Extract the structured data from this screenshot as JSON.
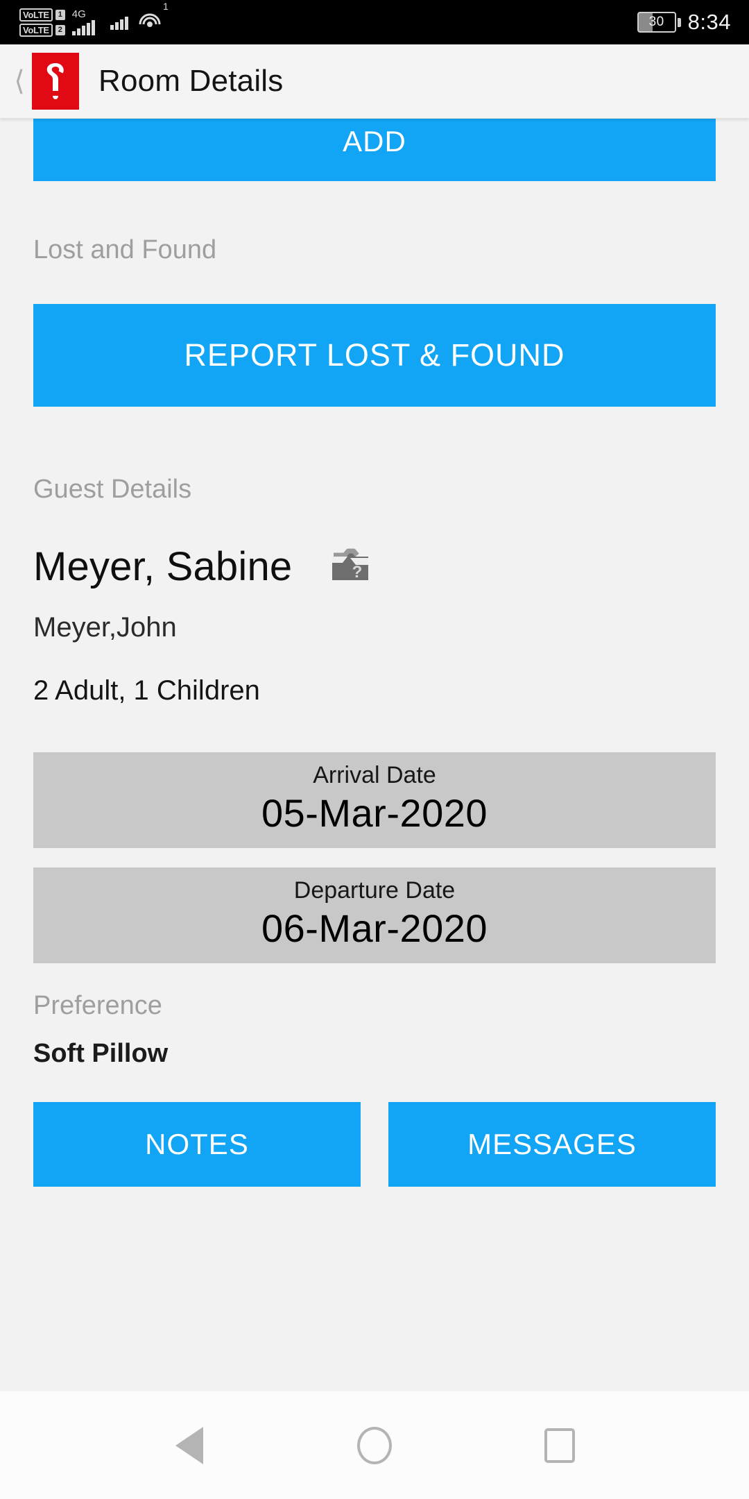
{
  "status_bar": {
    "volte_label": "VoLTE",
    "sim1_number": "1",
    "sim2_number": "2",
    "network_type": "4G",
    "hotspot_superscript": "1",
    "battery_percent": "30",
    "time": "8:34"
  },
  "app_bar": {
    "back_icon": "back-chevron-icon",
    "logo_icon": "door-hanger-logo-icon",
    "title": "Room Details"
  },
  "main": {
    "add_button_label": "ADD",
    "lost_and_found": {
      "section_label": "Lost and Found",
      "report_button_label": "REPORT LOST & FOUND"
    },
    "guest_details": {
      "section_label": "Guest Details",
      "guest_name": "Meyer, Sabine",
      "guest_photo_icon": "broken-image-icon",
      "secondary_guest": "Meyer,John",
      "occupancy": "2 Adult, 1 Children",
      "arrival": {
        "label": "Arrival Date",
        "value": "05-Mar-2020"
      },
      "departure": {
        "label": "Departure Date",
        "value": "06-Mar-2020"
      }
    },
    "preference": {
      "section_label": "Preference",
      "value": "Soft Pillow"
    },
    "actions": {
      "notes_label": "NOTES",
      "messages_label": "MESSAGES"
    }
  },
  "nav_bar": {
    "back": "back-triangle-icon",
    "home": "home-circle-icon",
    "recents": "recents-square-icon"
  },
  "colors": {
    "accent_blue": "#12a4f5",
    "logo_red": "#e00914",
    "date_card_grey": "#c8c8c8",
    "section_label_grey": "#9e9e9e"
  }
}
